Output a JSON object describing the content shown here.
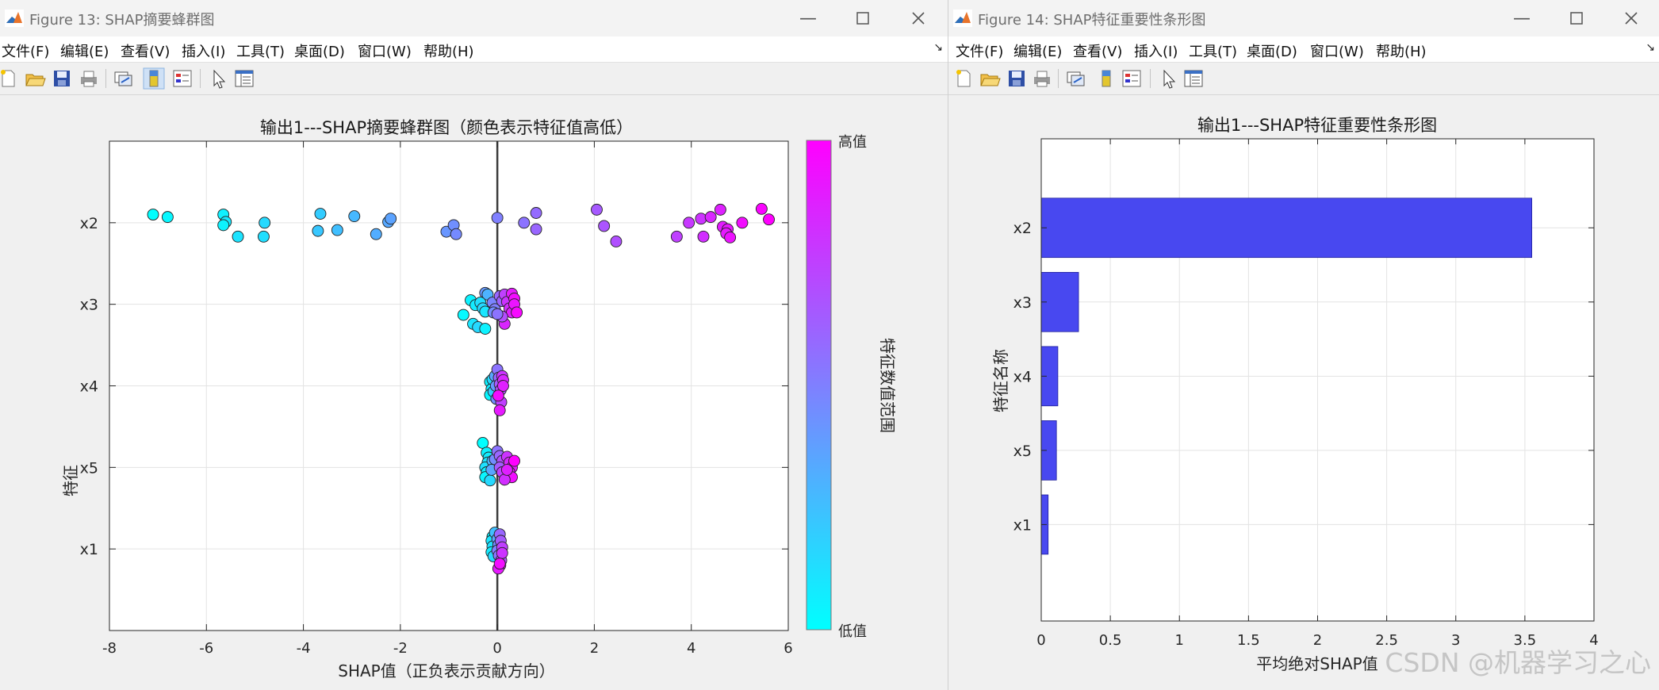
{
  "window_left": {
    "title": "Figure 13: SHAP摘要蜂群图",
    "menu": [
      "文件(F)",
      "编辑(E)",
      "查看(V)",
      "插入(I)",
      "工具(T)",
      "桌面(D)",
      "窗口(W)",
      "帮助(H)"
    ],
    "toolbar_icons": [
      "new-figure-icon",
      "open-file-icon",
      "save-icon",
      "print-icon",
      "link-plot-icon",
      "colorbar-icon",
      "legend-icon",
      "edit-plot-arrow-icon",
      "property-inspector-icon"
    ]
  },
  "window_right": {
    "title": "Figure 14: SHAP特征重要性条形图",
    "menu": [
      "文件(F)",
      "编辑(E)",
      "查看(V)",
      "插入(I)",
      "工具(T)",
      "桌面(D)",
      "窗口(W)",
      "帮助(H)"
    ],
    "toolbar_icons": [
      "new-figure-icon",
      "open-file-icon",
      "save-icon",
      "print-icon",
      "link-plot-icon",
      "colorbar-icon",
      "legend-icon",
      "edit-plot-arrow-icon",
      "property-inspector-icon"
    ]
  },
  "watermark": "CSDN @机器学习之心",
  "chart_data": [
    {
      "type": "scatter",
      "title": "输出1---SHAP摘要蜂群图（颜色表示特征值高低）",
      "xlabel": "SHAP值（正负表示贡献方向）",
      "ylabel": "特征",
      "categories": [
        "x2",
        "x3",
        "x4",
        "x5",
        "x1"
      ],
      "xlim": [
        -8,
        6
      ],
      "xticks": [
        -8,
        -6,
        -4,
        -2,
        0,
        2,
        4,
        6
      ],
      "grid": true,
      "zero_line": 0,
      "colorbar": {
        "label": "特征数值范围",
        "low_label": "低值",
        "high_label": "高值",
        "low_color": "#00ffff",
        "high_color": "#ff00ff"
      },
      "series": [
        {
          "category": "x2",
          "points": [
            [
              -7.1,
              0.1,
              0.0
            ],
            [
              -6.8,
              0.07,
              0.03
            ],
            [
              -5.65,
              0.1,
              0.06
            ],
            [
              -5.6,
              0.01,
              0.09
            ],
            [
              -5.65,
              -0.03,
              0.05
            ],
            [
              -5.35,
              -0.17,
              0.11
            ],
            [
              -4.8,
              0.0,
              0.15
            ],
            [
              -4.82,
              -0.17,
              0.13
            ],
            [
              -3.65,
              0.11,
              0.2
            ],
            [
              -3.7,
              -0.1,
              0.22
            ],
            [
              -3.3,
              -0.09,
              0.25
            ],
            [
              -2.95,
              0.08,
              0.28
            ],
            [
              -2.5,
              -0.14,
              0.32
            ],
            [
              -2.25,
              0.01,
              0.34
            ],
            [
              -2.2,
              0.05,
              0.36
            ],
            [
              -1.05,
              -0.11,
              0.41
            ],
            [
              -0.9,
              -0.03,
              0.44
            ],
            [
              -0.85,
              -0.14,
              0.46
            ],
            [
              0.0,
              0.06,
              0.5
            ],
            [
              0.55,
              0.0,
              0.55
            ],
            [
              0.8,
              0.12,
              0.58
            ],
            [
              0.8,
              -0.08,
              0.6
            ],
            [
              2.05,
              0.16,
              0.65
            ],
            [
              2.2,
              -0.04,
              0.67
            ],
            [
              2.45,
              -0.23,
              0.69
            ],
            [
              3.7,
              -0.17,
              0.75
            ],
            [
              3.95,
              0.0,
              0.78
            ],
            [
              4.2,
              0.05,
              0.8
            ],
            [
              4.25,
              -0.17,
              0.82
            ],
            [
              4.4,
              0.07,
              0.85
            ],
            [
              4.6,
              0.16,
              0.87
            ],
            [
              4.65,
              -0.05,
              0.89
            ],
            [
              4.75,
              -0.08,
              0.91
            ],
            [
              4.72,
              -0.13,
              0.9
            ],
            [
              4.8,
              -0.18,
              0.93
            ],
            [
              5.05,
              0.0,
              0.95
            ],
            [
              5.45,
              0.17,
              0.98
            ],
            [
              5.6,
              0.04,
              1.0
            ]
          ]
        },
        {
          "category": "x3",
          "points": [
            [
              -0.25,
              0.14,
              0.4
            ],
            [
              -0.2,
              0.12,
              0.3
            ],
            [
              -0.55,
              0.05,
              0.05
            ],
            [
              -0.45,
              -0.01,
              0.08
            ],
            [
              -0.35,
              0.02,
              0.12
            ],
            [
              -0.3,
              -0.05,
              0.15
            ],
            [
              -0.25,
              -0.09,
              0.1
            ],
            [
              -0.7,
              -0.13,
              0.02
            ],
            [
              -0.5,
              -0.24,
              0.1
            ],
            [
              -0.4,
              -0.28,
              0.15
            ],
            [
              -0.25,
              -0.3,
              0.05
            ],
            [
              -0.1,
              0.02,
              0.48
            ],
            [
              -0.05,
              -0.06,
              0.5
            ],
            [
              -0.08,
              -0.1,
              0.45
            ],
            [
              0.05,
              0.1,
              0.6
            ],
            [
              0.1,
              0.04,
              0.62
            ],
            [
              0.15,
              0.12,
              0.75
            ],
            [
              0.2,
              0.03,
              0.8
            ],
            [
              0.25,
              -0.05,
              0.83
            ],
            [
              0.3,
              -0.1,
              0.88
            ],
            [
              0.3,
              0.13,
              0.9
            ],
            [
              0.35,
              0.07,
              0.95
            ],
            [
              0.35,
              0.0,
              0.92
            ],
            [
              0.4,
              -0.1,
              0.97
            ],
            [
              0.15,
              -0.24,
              0.85
            ],
            [
              0.1,
              -0.15,
              0.7
            ],
            [
              0.0,
              -0.12,
              0.55
            ]
          ]
        },
        {
          "category": "x4",
          "points": [
            [
              -0.15,
              0.05,
              0.05
            ],
            [
              -0.12,
              -0.04,
              0.08
            ],
            [
              -0.15,
              -0.11,
              0.03
            ],
            [
              -0.1,
              0.08,
              0.15
            ],
            [
              -0.08,
              -0.07,
              0.2
            ],
            [
              -0.05,
              0.12,
              0.35
            ],
            [
              -0.03,
              0.0,
              0.4
            ],
            [
              -0.02,
              -0.16,
              0.45
            ],
            [
              0.0,
              0.2,
              0.55
            ],
            [
              0.03,
              0.1,
              0.6
            ],
            [
              0.05,
              0.02,
              0.65
            ],
            [
              0.07,
              -0.05,
              0.7
            ],
            [
              0.08,
              -0.2,
              0.75
            ],
            [
              0.1,
              0.12,
              0.8
            ],
            [
              0.12,
              0.07,
              0.85
            ],
            [
              0.12,
              0.0,
              0.88
            ],
            [
              0.05,
              -0.3,
              0.9
            ],
            [
              0.02,
              -0.12,
              0.95
            ]
          ]
        },
        {
          "category": "x5",
          "points": [
            [
              -0.3,
              0.3,
              0.0
            ],
            [
              -0.22,
              0.18,
              0.05
            ],
            [
              -0.18,
              0.12,
              0.08
            ],
            [
              -0.2,
              0.06,
              0.1
            ],
            [
              -0.25,
              0.0,
              0.12
            ],
            [
              -0.22,
              -0.06,
              0.06
            ],
            [
              -0.25,
              -0.12,
              0.04
            ],
            [
              -0.15,
              -0.16,
              0.15
            ],
            [
              -0.1,
              0.08,
              0.3
            ],
            [
              -0.12,
              -0.03,
              0.35
            ],
            [
              -0.05,
              0.1,
              0.45
            ],
            [
              0.0,
              0.2,
              0.55
            ],
            [
              0.05,
              0.14,
              0.6
            ],
            [
              0.1,
              0.08,
              0.7
            ],
            [
              0.05,
              0.0,
              0.65
            ],
            [
              0.1,
              -0.06,
              0.75
            ],
            [
              0.2,
              0.13,
              0.8
            ],
            [
              0.25,
              0.06,
              0.85
            ],
            [
              0.3,
              0.0,
              0.9
            ],
            [
              0.25,
              -0.06,
              0.92
            ],
            [
              0.3,
              -0.12,
              0.95
            ],
            [
              0.35,
              0.08,
              1.0
            ],
            [
              0.15,
              -0.15,
              0.82
            ],
            [
              0.2,
              -0.03,
              0.88
            ]
          ]
        },
        {
          "category": "x1",
          "points": [
            [
              -0.1,
              0.15,
              0.05
            ],
            [
              -0.12,
              0.1,
              0.1
            ],
            [
              -0.1,
              0.03,
              0.12
            ],
            [
              -0.12,
              -0.04,
              0.08
            ],
            [
              -0.08,
              -0.09,
              0.15
            ],
            [
              -0.05,
              0.2,
              0.25
            ],
            [
              0.0,
              0.12,
              0.35
            ],
            [
              0.02,
              0.05,
              0.45
            ],
            [
              0.0,
              -0.02,
              0.5
            ],
            [
              0.03,
              -0.08,
              0.55
            ],
            [
              0.05,
              0.18,
              0.6
            ],
            [
              0.07,
              0.1,
              0.65
            ],
            [
              0.08,
              -0.14,
              0.7
            ],
            [
              0.1,
              0.02,
              0.75
            ],
            [
              0.1,
              -0.05,
              0.8
            ],
            [
              0.06,
              -0.2,
              0.85
            ],
            [
              0.02,
              -0.24,
              0.9
            ],
            [
              0.05,
              -0.18,
              0.95
            ]
          ]
        }
      ]
    },
    {
      "type": "bar",
      "orientation": "horizontal",
      "title": "输出1---SHAP特征重要性条形图",
      "xlabel": "平均绝对SHAP值",
      "ylabel": "特征名称",
      "categories": [
        "x2",
        "x3",
        "x4",
        "x5",
        "x1"
      ],
      "values": [
        3.55,
        0.27,
        0.12,
        0.11,
        0.05
      ],
      "xlim": [
        0,
        4
      ],
      "xticks": [
        0,
        0.5,
        1,
        1.5,
        2,
        2.5,
        3,
        3.5,
        4
      ],
      "xtick_labels": [
        "0",
        "0.5",
        "1",
        "1.5",
        "2",
        "2.5",
        "3",
        "3.5",
        "4"
      ],
      "grid": true,
      "bar_color": "#4848f0"
    }
  ]
}
